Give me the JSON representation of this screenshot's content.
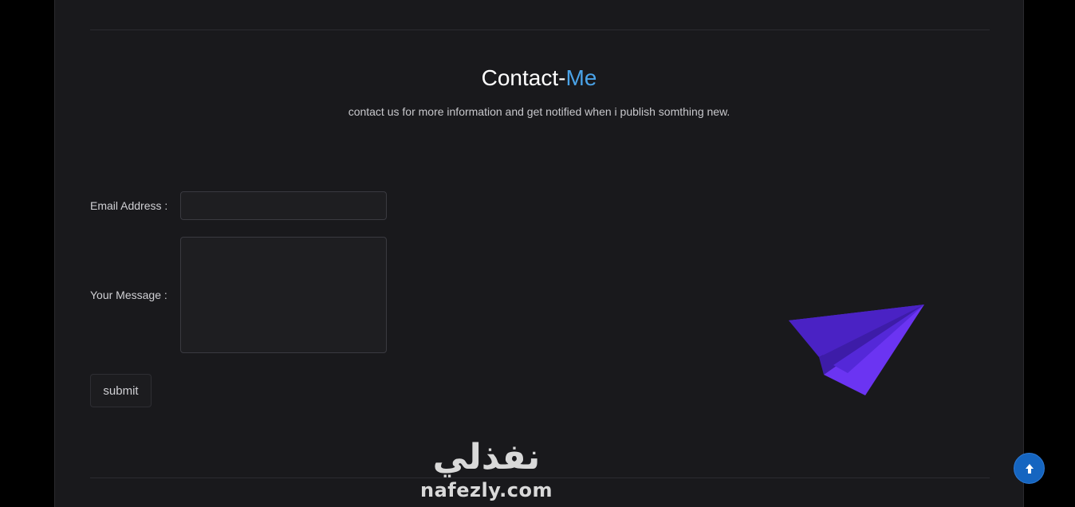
{
  "contact": {
    "title_main": "Contact-",
    "title_accent": "Me",
    "subtitle": "contact us for more information and get notified when i publish somthing new."
  },
  "form": {
    "email_label": "Email Address :",
    "email_value": "",
    "message_label": "Your Message :",
    "message_value": "",
    "submit_label": "submit"
  },
  "watermark": {
    "arabic": "نفذلي",
    "latin": "nafezly.com"
  },
  "icons": {
    "plane": "paper-plane-icon",
    "scroll_top": "arrow-up-icon"
  },
  "colors": {
    "accent": "#4aa3e8",
    "plane": "#6a2cf0",
    "scroll_button": "#1565c0"
  }
}
